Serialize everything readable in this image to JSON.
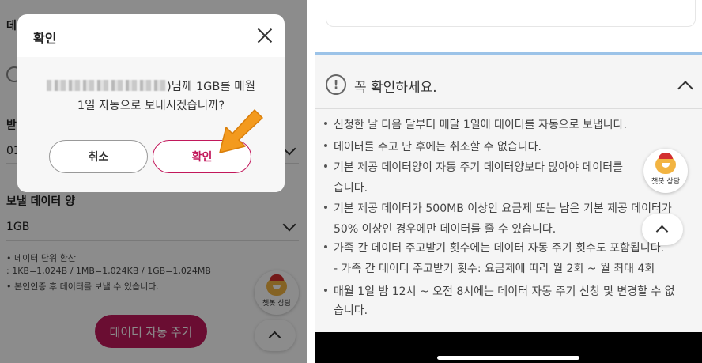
{
  "left": {
    "clipped_heading": "데",
    "clipped_label": "받",
    "clipped_value": "01",
    "data_amount_label": "보낼 데이터 양",
    "data_amount_value": "1GB",
    "info_lines": [
      "• 데이터 단위 환산",
      "  : 1KB=1,024B / 1MB=1,024KB / 1GB=1,024MB",
      "• 본인인증 후 데이터를 보낼 수 있습니다."
    ],
    "primary_button": "데이터 자동 주기",
    "chatbot_label": "챗봇 상담"
  },
  "dialog": {
    "title": "확인",
    "message_line1_suffix": ")님께 1GB를 매월",
    "message_line2": "1일 자동으로 보내시겠습니까?",
    "cancel_label": "취소",
    "confirm_label": "확인"
  },
  "right": {
    "notice_title": "꼭 확인하세요.",
    "warn_symbol": "!",
    "lines": [
      {
        "kind": "bullet",
        "text": "신청한 날 다음 달부터 매달 1일에 데이터를 자동으로 보냅니다."
      },
      {
        "kind": "bullet",
        "text": "데이터를 주고 난 후에는 취소할 수 없습니다."
      },
      {
        "kind": "bullet",
        "text": "기본 제공 데이터양이 자동 주기 데이터양보다 많아야 데이터를"
      },
      {
        "kind": "cont",
        "text": "습니다."
      },
      {
        "kind": "bullet",
        "text": "기본 제공 데이터가 500MB 이상인 요금제 또는 남은 기본 제공 데이터가"
      },
      {
        "kind": "cont",
        "text": "50% 이상인 경우에만 데이터를 줄 수 있습니다."
      },
      {
        "kind": "bullet",
        "text": "가족 간 데이터 주고받기 횟수에는 데이터 자동 주기 횟수도 포함됩니다."
      },
      {
        "kind": "cont",
        "text": "- 가족 간 데이터 주고받기 횟수: 요금제에 따라 월 2회 ~ 월 최대 4회"
      },
      {
        "kind": "bullet",
        "text": "매월 1일 밤 12시 ~ 오전 8시에는 데이터 자동 주기 신청 및 변경할 수 없"
      },
      {
        "kind": "cont",
        "text": "습니다."
      }
    ],
    "chatbot_label": "챗봇 상담"
  },
  "colors": {
    "brand": "#c2185b",
    "highlight_arrow": "#f39a1e",
    "accent_bar": "#9cc3e8"
  }
}
